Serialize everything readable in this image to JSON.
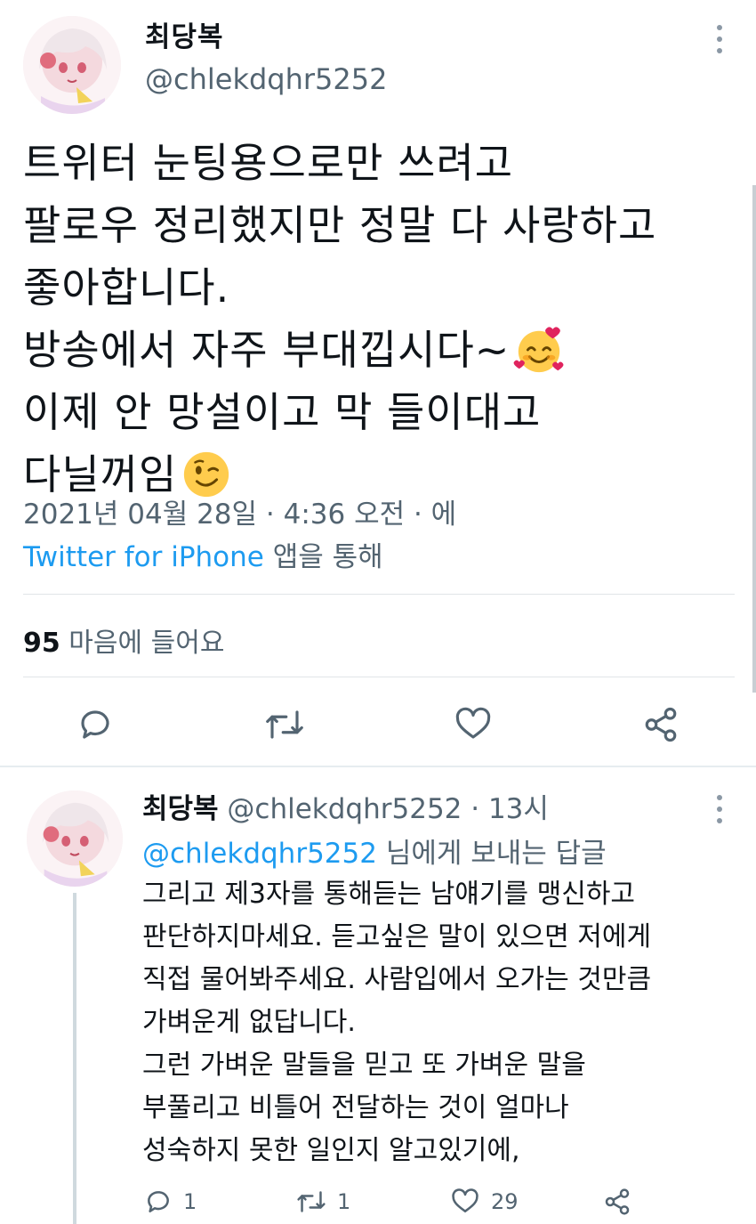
{
  "main_tweet": {
    "author_name": "최당복",
    "handle": "@chlekdqhr5252",
    "text_lines": [
      "트위터 눈팅용으로만 쓰려고",
      "팔로우 정리했지만 정말 다 사랑하고",
      "좋아합니다.",
      "방송에서 자주 부대낍시다~",
      "이제 안 망설이고 막 들이대고",
      "다닐꺼임"
    ],
    "emoji_line4": "smiling-face-with-hearts-emoji",
    "emoji_line6": "winking-face-emoji",
    "date": "2021년 04월 28일 · 4:36 오전 · 에",
    "source": "Twitter for iPhone",
    "source_suffix": " 앱을 통해",
    "likes_count": "95",
    "likes_label": " 마음에 들어요",
    "actions": [
      "reply-icon",
      "retweet-icon",
      "like-icon",
      "share-icon"
    ]
  },
  "reply_tweet": {
    "author_name": "최당복",
    "handle_time": " @chlekdqhr5252 · 13시",
    "reply_to_mention": "@chlekdqhr5252",
    "reply_to_suffix": " 님에게 보내는 답글",
    "text_lines": [
      "그리고 제3자를 통해듣는 남얘기를 맹신하고",
      "판단하지마세요. 듣고싶은 말이 있으면 저에게",
      "직접 물어봐주세요. 사람입에서 오가는 것만큼",
      "가벼운게 없답니다.",
      "그런 가벼운 말들을 믿고 또 가벼운 말을",
      "부풀리고 비틀어 전달하는 것이 얼마나",
      "성숙하지 못한 일인지 알고있기에,"
    ],
    "reply_count": "1",
    "retweet_count": "1",
    "like_count": "29"
  },
  "colors": {
    "accent": "#1d9bf0",
    "secondary_text": "#536471",
    "primary_text": "#0f1419",
    "divider": "#e1e5e8"
  }
}
